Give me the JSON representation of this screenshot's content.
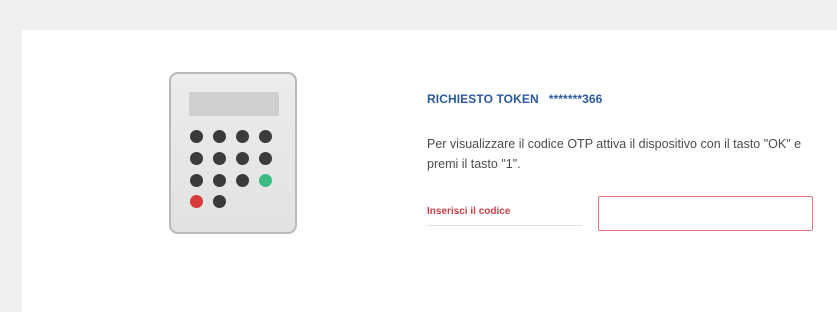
{
  "token_panel": {
    "title": "RICHIESTO TOKEN",
    "token_serial": "*******366",
    "instructions": "Per visualizzare il codice OTP attiva il dispositivo con il tasto \"OK\" e premi il tasto \"1\".",
    "code_label": "Inserisci il codice",
    "code_value": "",
    "code_placeholder": ""
  },
  "device_illustration": {
    "icon": "token-keypad-icon",
    "ok_key_color": "#3dbb85",
    "cancel_key_color": "#d63a3a",
    "key_color": "#3b3b3b"
  },
  "colors": {
    "title": "#2a5aa0",
    "label": "#c8414a",
    "input_border": "#e0727a",
    "background": "#f0f0f0",
    "card": "#ffffff"
  }
}
